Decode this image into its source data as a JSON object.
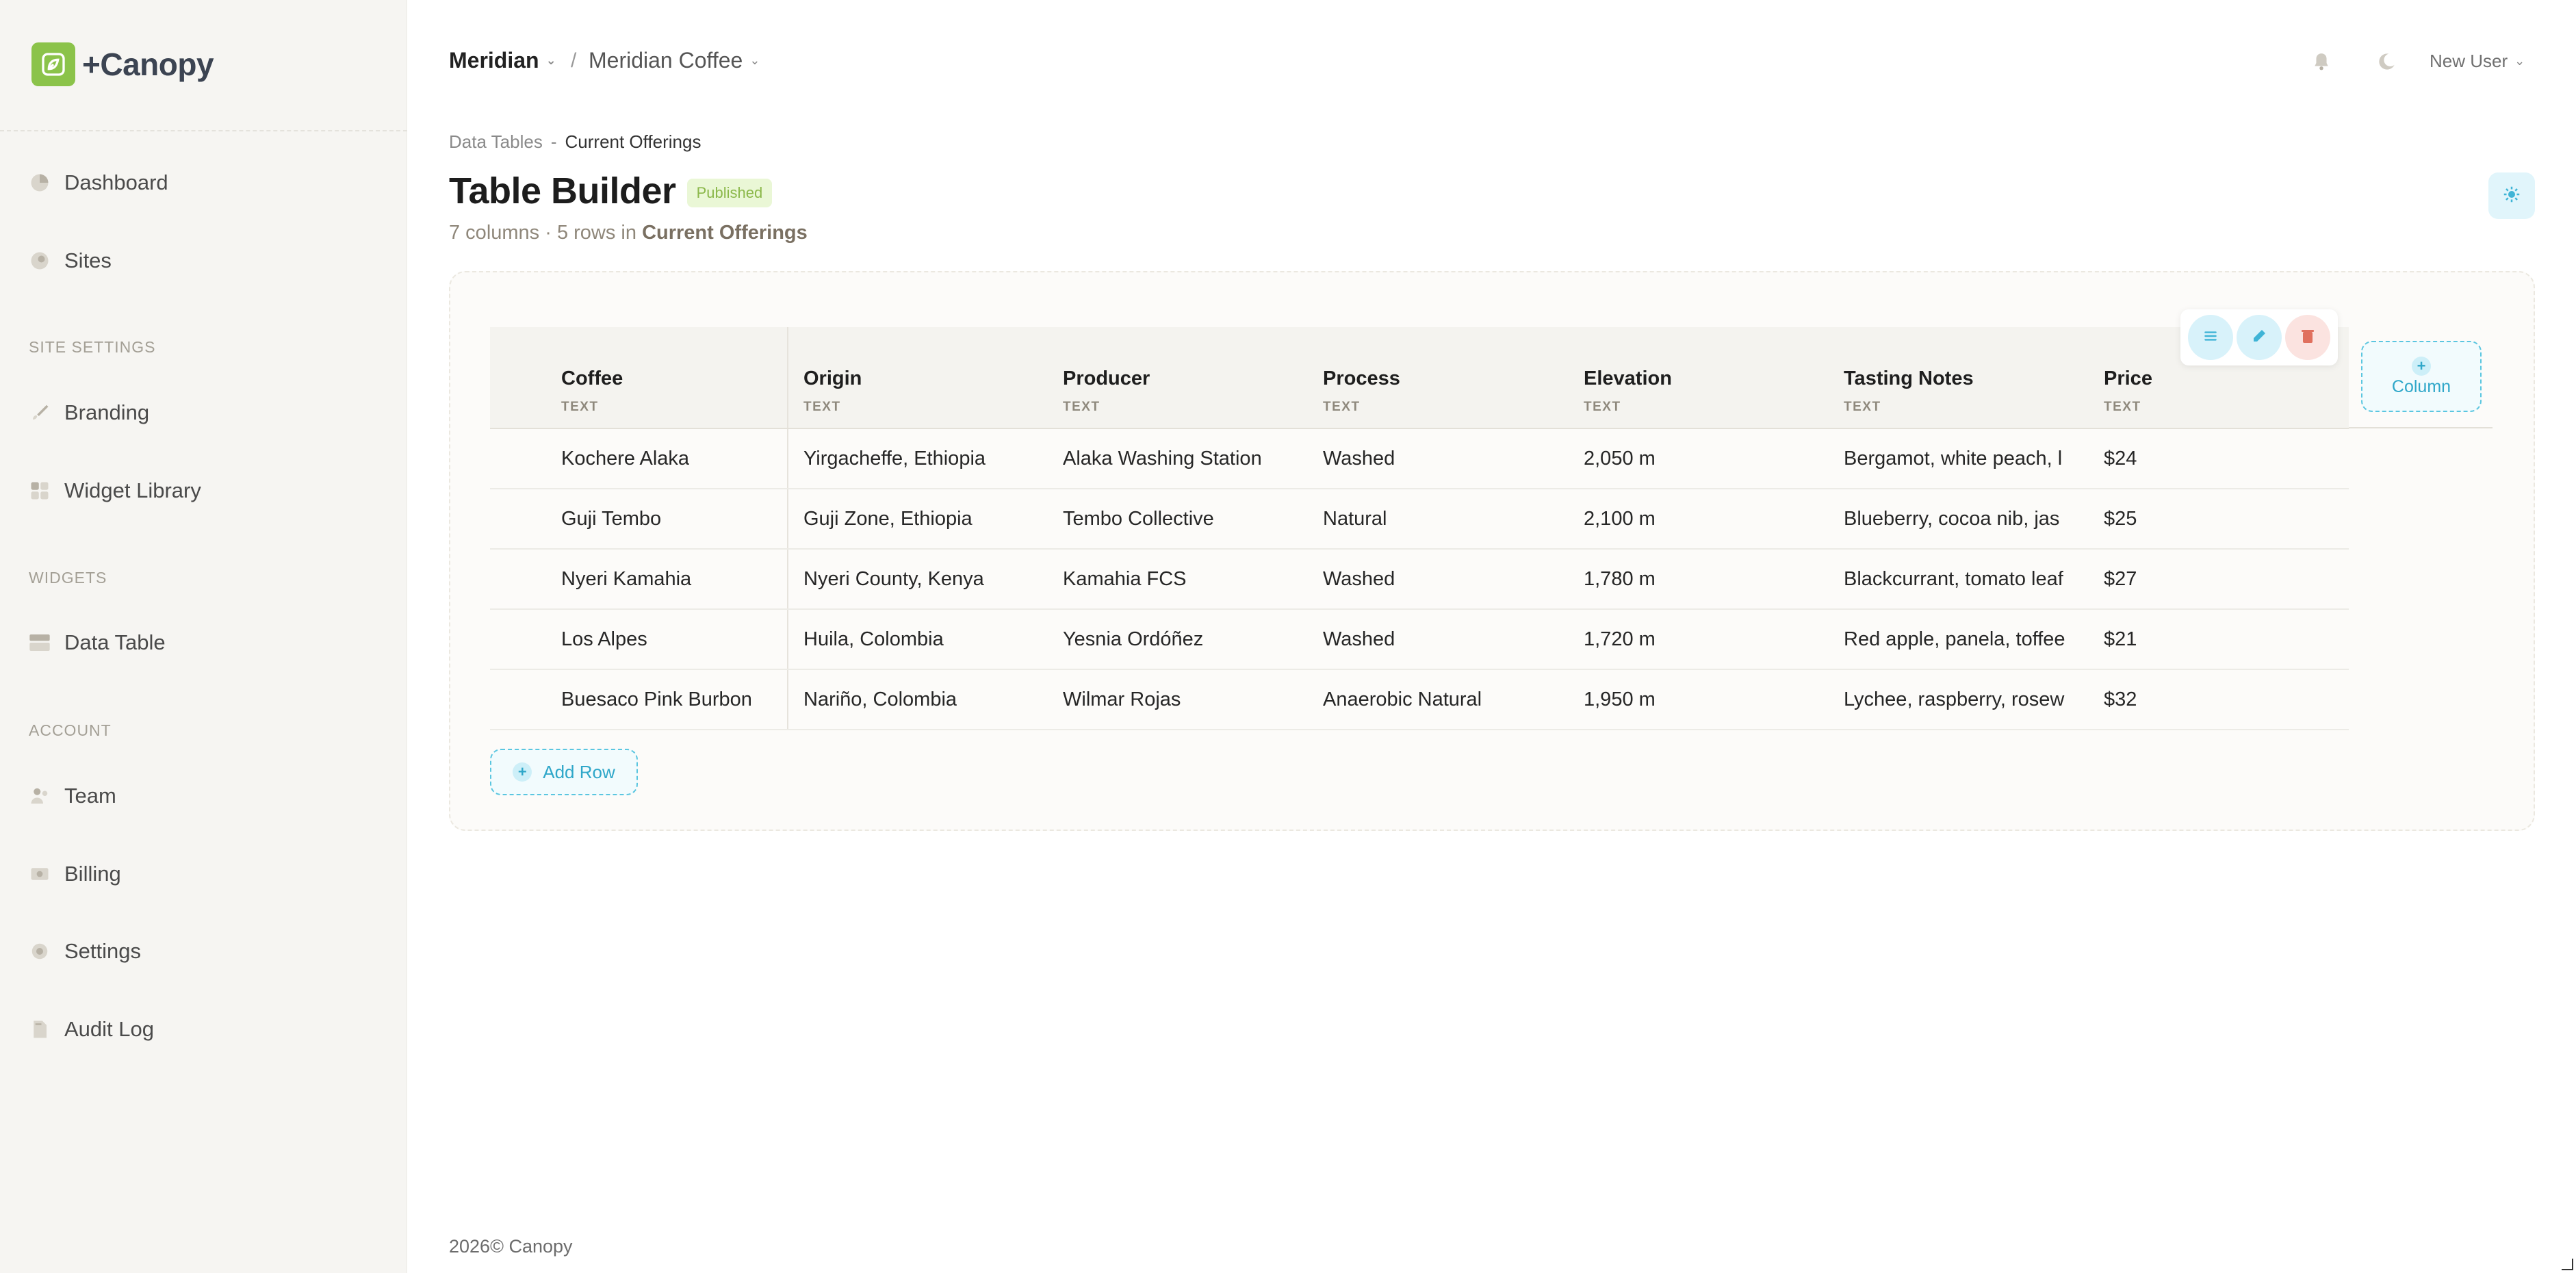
{
  "brand": {
    "name": "+Canopy",
    "logo_icon": "canopy-leaf-icon",
    "logo_color": "#8bc34a"
  },
  "sidebar": {
    "items": [
      {
        "label": "Dashboard",
        "icon": "pie-chart-icon"
      },
      {
        "label": "Sites",
        "icon": "globe-icon"
      }
    ],
    "site_settings": {
      "title": "SITE SETTINGS",
      "items": [
        {
          "label": "Branding",
          "icon": "paintbrush-icon"
        },
        {
          "label": "Widget Library",
          "icon": "widgets-grid-icon"
        }
      ]
    },
    "widgets": {
      "title": "WIDGETS",
      "items": [
        {
          "label": "Data Table",
          "icon": "table-icon"
        }
      ]
    },
    "account": {
      "title": "ACCOUNT",
      "items": [
        {
          "label": "Team",
          "icon": "team-icon"
        },
        {
          "label": "Billing",
          "icon": "billing-icon"
        },
        {
          "label": "Settings",
          "icon": "gear-icon"
        },
        {
          "label": "Audit Log",
          "icon": "document-icon"
        }
      ]
    }
  },
  "topbar": {
    "org": "Meridian",
    "separator": "/",
    "site": "Meridian Coffee",
    "user": "New User"
  },
  "breadcrumb": {
    "parent": "Data Tables",
    "sep": "-",
    "current": "Current Offerings"
  },
  "page": {
    "title": "Table Builder",
    "status": "Published",
    "summary_prefix": "7 columns · 5 rows in",
    "summary_table": "Current Offerings"
  },
  "table": {
    "columns": [
      {
        "label": "Coffee",
        "type": "TEXT"
      },
      {
        "label": "Origin",
        "type": "TEXT"
      },
      {
        "label": "Producer",
        "type": "TEXT"
      },
      {
        "label": "Process",
        "type": "TEXT"
      },
      {
        "label": "Elevation",
        "type": "TEXT"
      },
      {
        "label": "Tasting Notes",
        "type": "TEXT"
      },
      {
        "label": "Price",
        "type": "TEXT"
      }
    ],
    "rows": [
      [
        "Kochere Alaka",
        "Yirgacheffe, Ethiopia",
        "Alaka Washing Station",
        "Washed",
        "2,050 m",
        "Bergamot, white peach, l",
        "$24"
      ],
      [
        "Guji Tembo",
        "Guji Zone, Ethiopia",
        "Tembo Collective",
        "Natural",
        "2,100 m",
        "Blueberry, cocoa nib, jas",
        "$25"
      ],
      [
        "Nyeri Kamahia",
        "Nyeri County, Kenya",
        "Kamahia FCS",
        "Washed",
        "1,780 m",
        "Blackcurrant, tomato leaf",
        "$27"
      ],
      [
        "Los Alpes",
        "Huila, Colombia",
        "Yesnia Ordóñez",
        "Washed",
        "1,720 m",
        "Red apple, panela, toffee",
        "$21"
      ],
      [
        "Buesaco Pink Burbon",
        "Nariño, Colombia",
        "Wilmar Rojas",
        "Anaerobic Natural",
        "1,950 m",
        "Lychee, raspberry, rosew",
        "$32"
      ]
    ]
  },
  "actions": {
    "add_column": "Column",
    "add_row": "Add Row"
  },
  "footer": {
    "text": "2026©  Canopy"
  },
  "colors": {
    "accent": "#2fa7c9",
    "danger": "#e0705e",
    "published": "#8bb84a"
  }
}
